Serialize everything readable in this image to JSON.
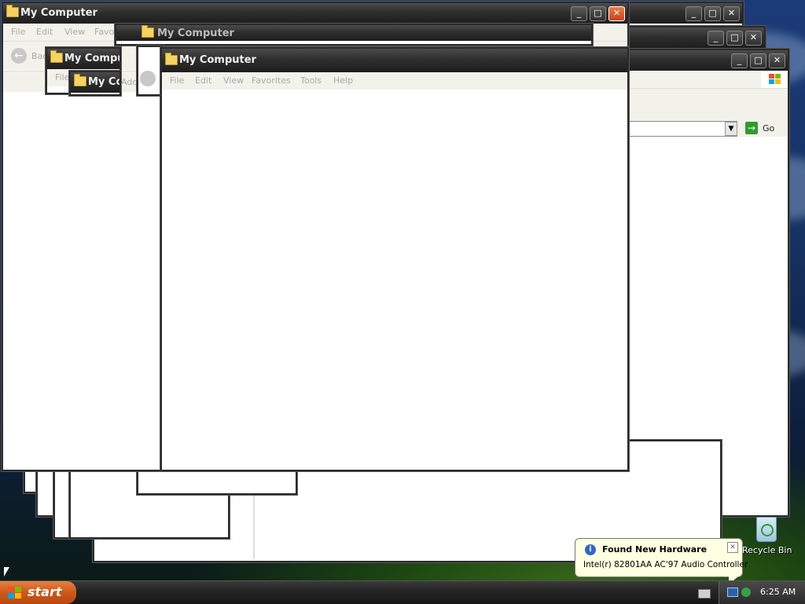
{
  "windows": {
    "title": "My Computer",
    "back_label": "Back",
    "address_label": "Add",
    "go_label": "Go",
    "partial": {
      "title_a": "My Compu",
      "title_b": "My Co",
      "file": "File",
      "favo": "Favo",
      "add": "Add",
      "bac": "Bac"
    }
  },
  "menu": {
    "file": "File",
    "edit": "Edit",
    "view": "View",
    "favorites": "Favorites",
    "tools": "Tools",
    "help": "Help"
  },
  "desktop": {
    "recycle_bin": "Recycle Bin"
  },
  "balloon": {
    "title": "Found New Hardware",
    "message": "Intel(r) 82801AA AC'97 Audio Controller"
  },
  "taskbar": {
    "start_label": "start",
    "clock": "6:25 AM"
  },
  "colors": {
    "start_button": "#d05a1c",
    "close_button": "#c8421a",
    "balloon_bg": "#ffffe1",
    "titlebar": "#2e2e2e"
  }
}
